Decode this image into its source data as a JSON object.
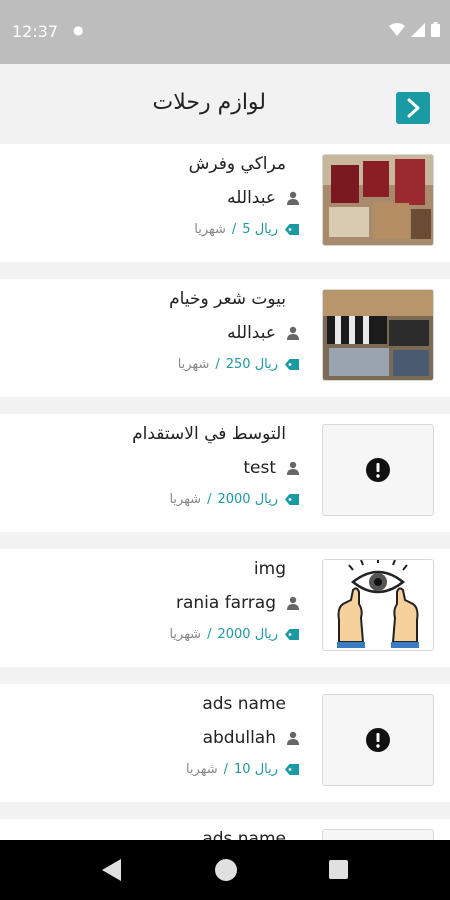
{
  "status": {
    "time": "12:37"
  },
  "header": {
    "title": "لوازم رحلات"
  },
  "items": [
    {
      "title": "مراكي وفرش",
      "owner": "عبدالله",
      "price": "5 ريال",
      "period": "شهريا",
      "image": "photo-1"
    },
    {
      "title": "بيوت شعر وخيام",
      "owner": "عبدالله",
      "price": "250 ريال",
      "period": "شهريا",
      "image": "photo-2"
    },
    {
      "title": "التوسط في الاستقدام",
      "owner": "test",
      "price": "2000 ريال",
      "period": "شهريا",
      "image": "image-missing"
    },
    {
      "title": "img",
      "owner": "rania farrag",
      "price": "2000 ريال",
      "period": "شهريا",
      "image": "eye-hands"
    },
    {
      "title": "ads name",
      "owner": "abdullah",
      "price": "10 ريال",
      "period": "شهريا",
      "image": "image-missing"
    },
    {
      "title": "ads name"
    }
  ],
  "colors": {
    "accent": "#1a9aa3",
    "statusbar": "#bdbdbd",
    "background": "#f2f2f2"
  }
}
